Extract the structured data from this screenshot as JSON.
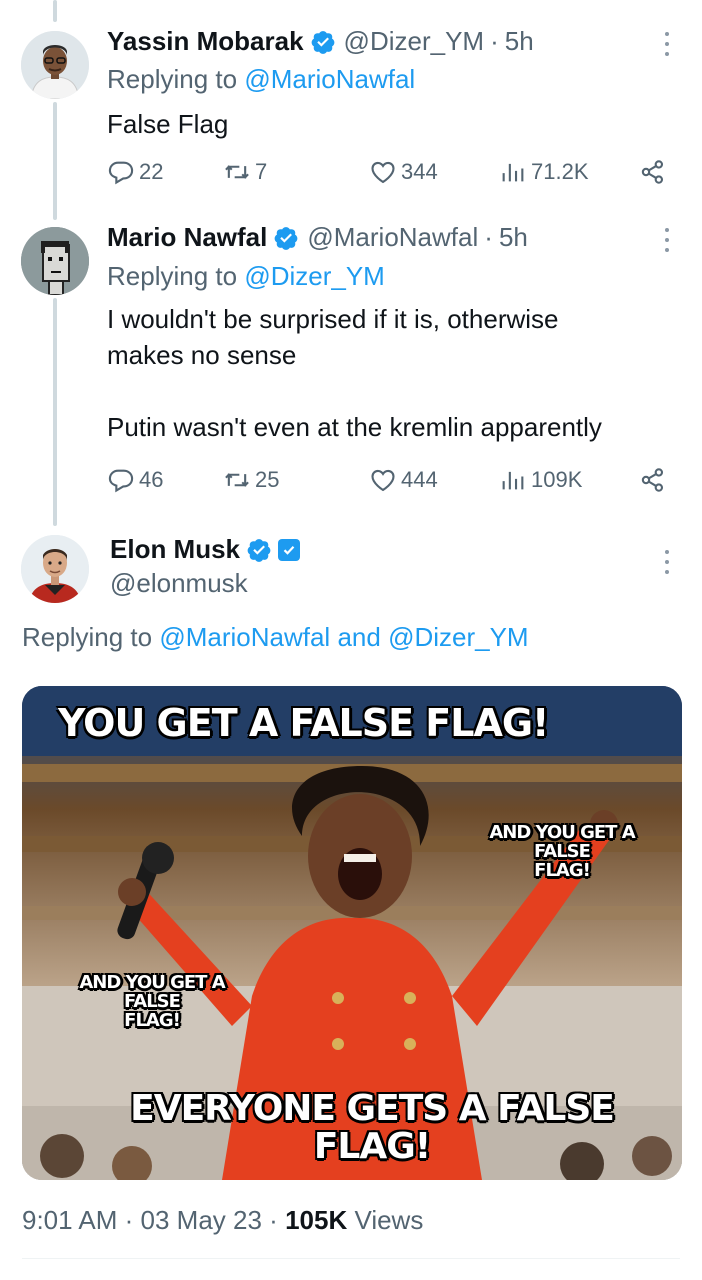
{
  "tweets": [
    {
      "name": "Yassin Mobarak",
      "handle": "@Dizer_YM",
      "time": "5h",
      "replying_prefix": "Replying to",
      "replying_to": "@MarioNawfal",
      "text_lines": [
        "False Flag"
      ],
      "replies": "22",
      "retweets": "7",
      "likes": "344",
      "views": "71.2K"
    },
    {
      "name": "Mario Nawfal",
      "handle": "@MarioNawfal",
      "time": "5h",
      "replying_prefix": "Replying to",
      "replying_to": "@Dizer_YM",
      "text_lines": [
        "I wouldn't be surprised if it is, otherwise",
        "makes no sense",
        "Putin wasn't even at the kremlin apparently"
      ],
      "replies": "46",
      "retweets": "25",
      "likes": "444",
      "views": "109K"
    }
  ],
  "main_tweet": {
    "name": "Elon Musk",
    "handle": "@elonmusk",
    "replying_prefix": "Replying to",
    "replying_mention_1": "@MarioNawfal",
    "replying_and": "and",
    "replying_mention_2": "@Dizer_YM",
    "meme": {
      "top_text": "YOU GET A FALSE FLAG!",
      "right_text_1": "AND YOU GET A FALSE",
      "right_text_2": "FLAG!",
      "left_text_1": "AND YOU GET A FALSE",
      "left_text_2": "FLAG!",
      "bottom_text": "EVERYONE GETS A FALSE FLAG!"
    },
    "time": "9:01 AM",
    "date": "03 May 23",
    "views_count": "105K",
    "views_label": "Views"
  },
  "icons": {
    "verified": "verified-badge-icon",
    "reply": "reply-icon",
    "retweet": "retweet-icon",
    "like": "heart-icon",
    "views": "views-icon",
    "share": "share-icon",
    "more": "more-icon"
  },
  "colors": {
    "accent": "#1d9bf0",
    "secondary_text": "#536471",
    "primary_text": "#0f1419",
    "thread_line": "#cfd9de"
  }
}
